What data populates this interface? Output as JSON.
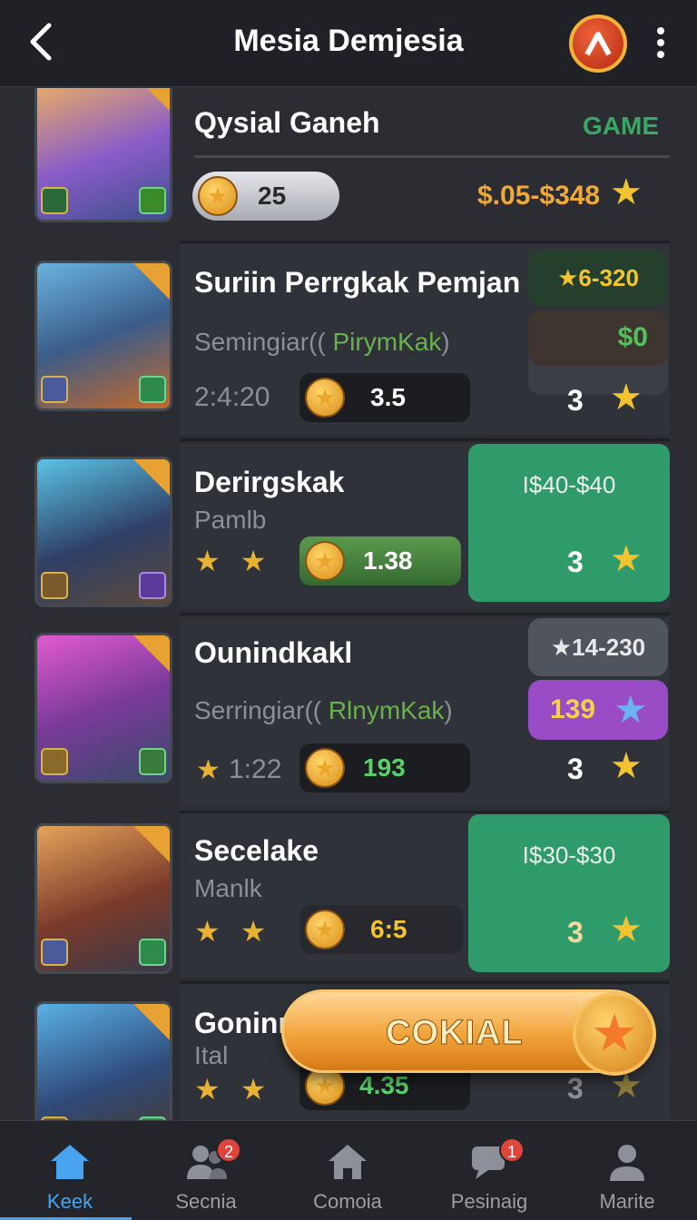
{
  "header": {
    "title": "Mesia Demjesia"
  },
  "rows": [
    {
      "name": "Qysial Ganeh",
      "tag": "GAME",
      "coin": "25",
      "price": "$.05-$348"
    },
    {
      "name": "Suriin Perrgkak Pemjan",
      "sub_a": "Semingiar((",
      "sub_b": "PirymKak",
      "sub_c": ")",
      "timer": "2:4:20",
      "coin": "3.5",
      "tag_top": "★6-320",
      "tag_bottom": "$0",
      "right_num": "3"
    },
    {
      "name": "Derirgskak",
      "sub": "Pamlb",
      "coin": "1.38",
      "price": "I$40-$40",
      "right_num": "3"
    },
    {
      "name": "Ounindkakl",
      "sub_a": "Serringiar((",
      "sub_b": "RlnymKak",
      "sub_c": ")",
      "timer": "1:22",
      "coin": "193",
      "tag_top": "★14-230",
      "tag_bottom": "139",
      "right_num": "3"
    },
    {
      "name": "Secelake",
      "sub": "Manlk",
      "coin": "6:5",
      "price": "I$30-$30",
      "right_num": "3"
    },
    {
      "name": "Goninı",
      "sub": "Ital",
      "coin": "4.35",
      "right_num": "3"
    }
  ],
  "cta": {
    "label": "COKIAL"
  },
  "tabs": [
    {
      "label": "Keek",
      "icon": "home-icon",
      "active": true
    },
    {
      "label": "Secnia",
      "icon": "people-icon",
      "badge": "2"
    },
    {
      "label": "Comoia",
      "icon": "house-icon"
    },
    {
      "label": "Pesinaig",
      "icon": "chat-icon",
      "badge": "1"
    },
    {
      "label": "Marite",
      "icon": "profile-icon"
    }
  ],
  "colors": {
    "accent": "#4aa3ef",
    "green_box": "#2f9a6a",
    "purple_tag": "#9a4cc6",
    "gold": "#f3c430"
  }
}
